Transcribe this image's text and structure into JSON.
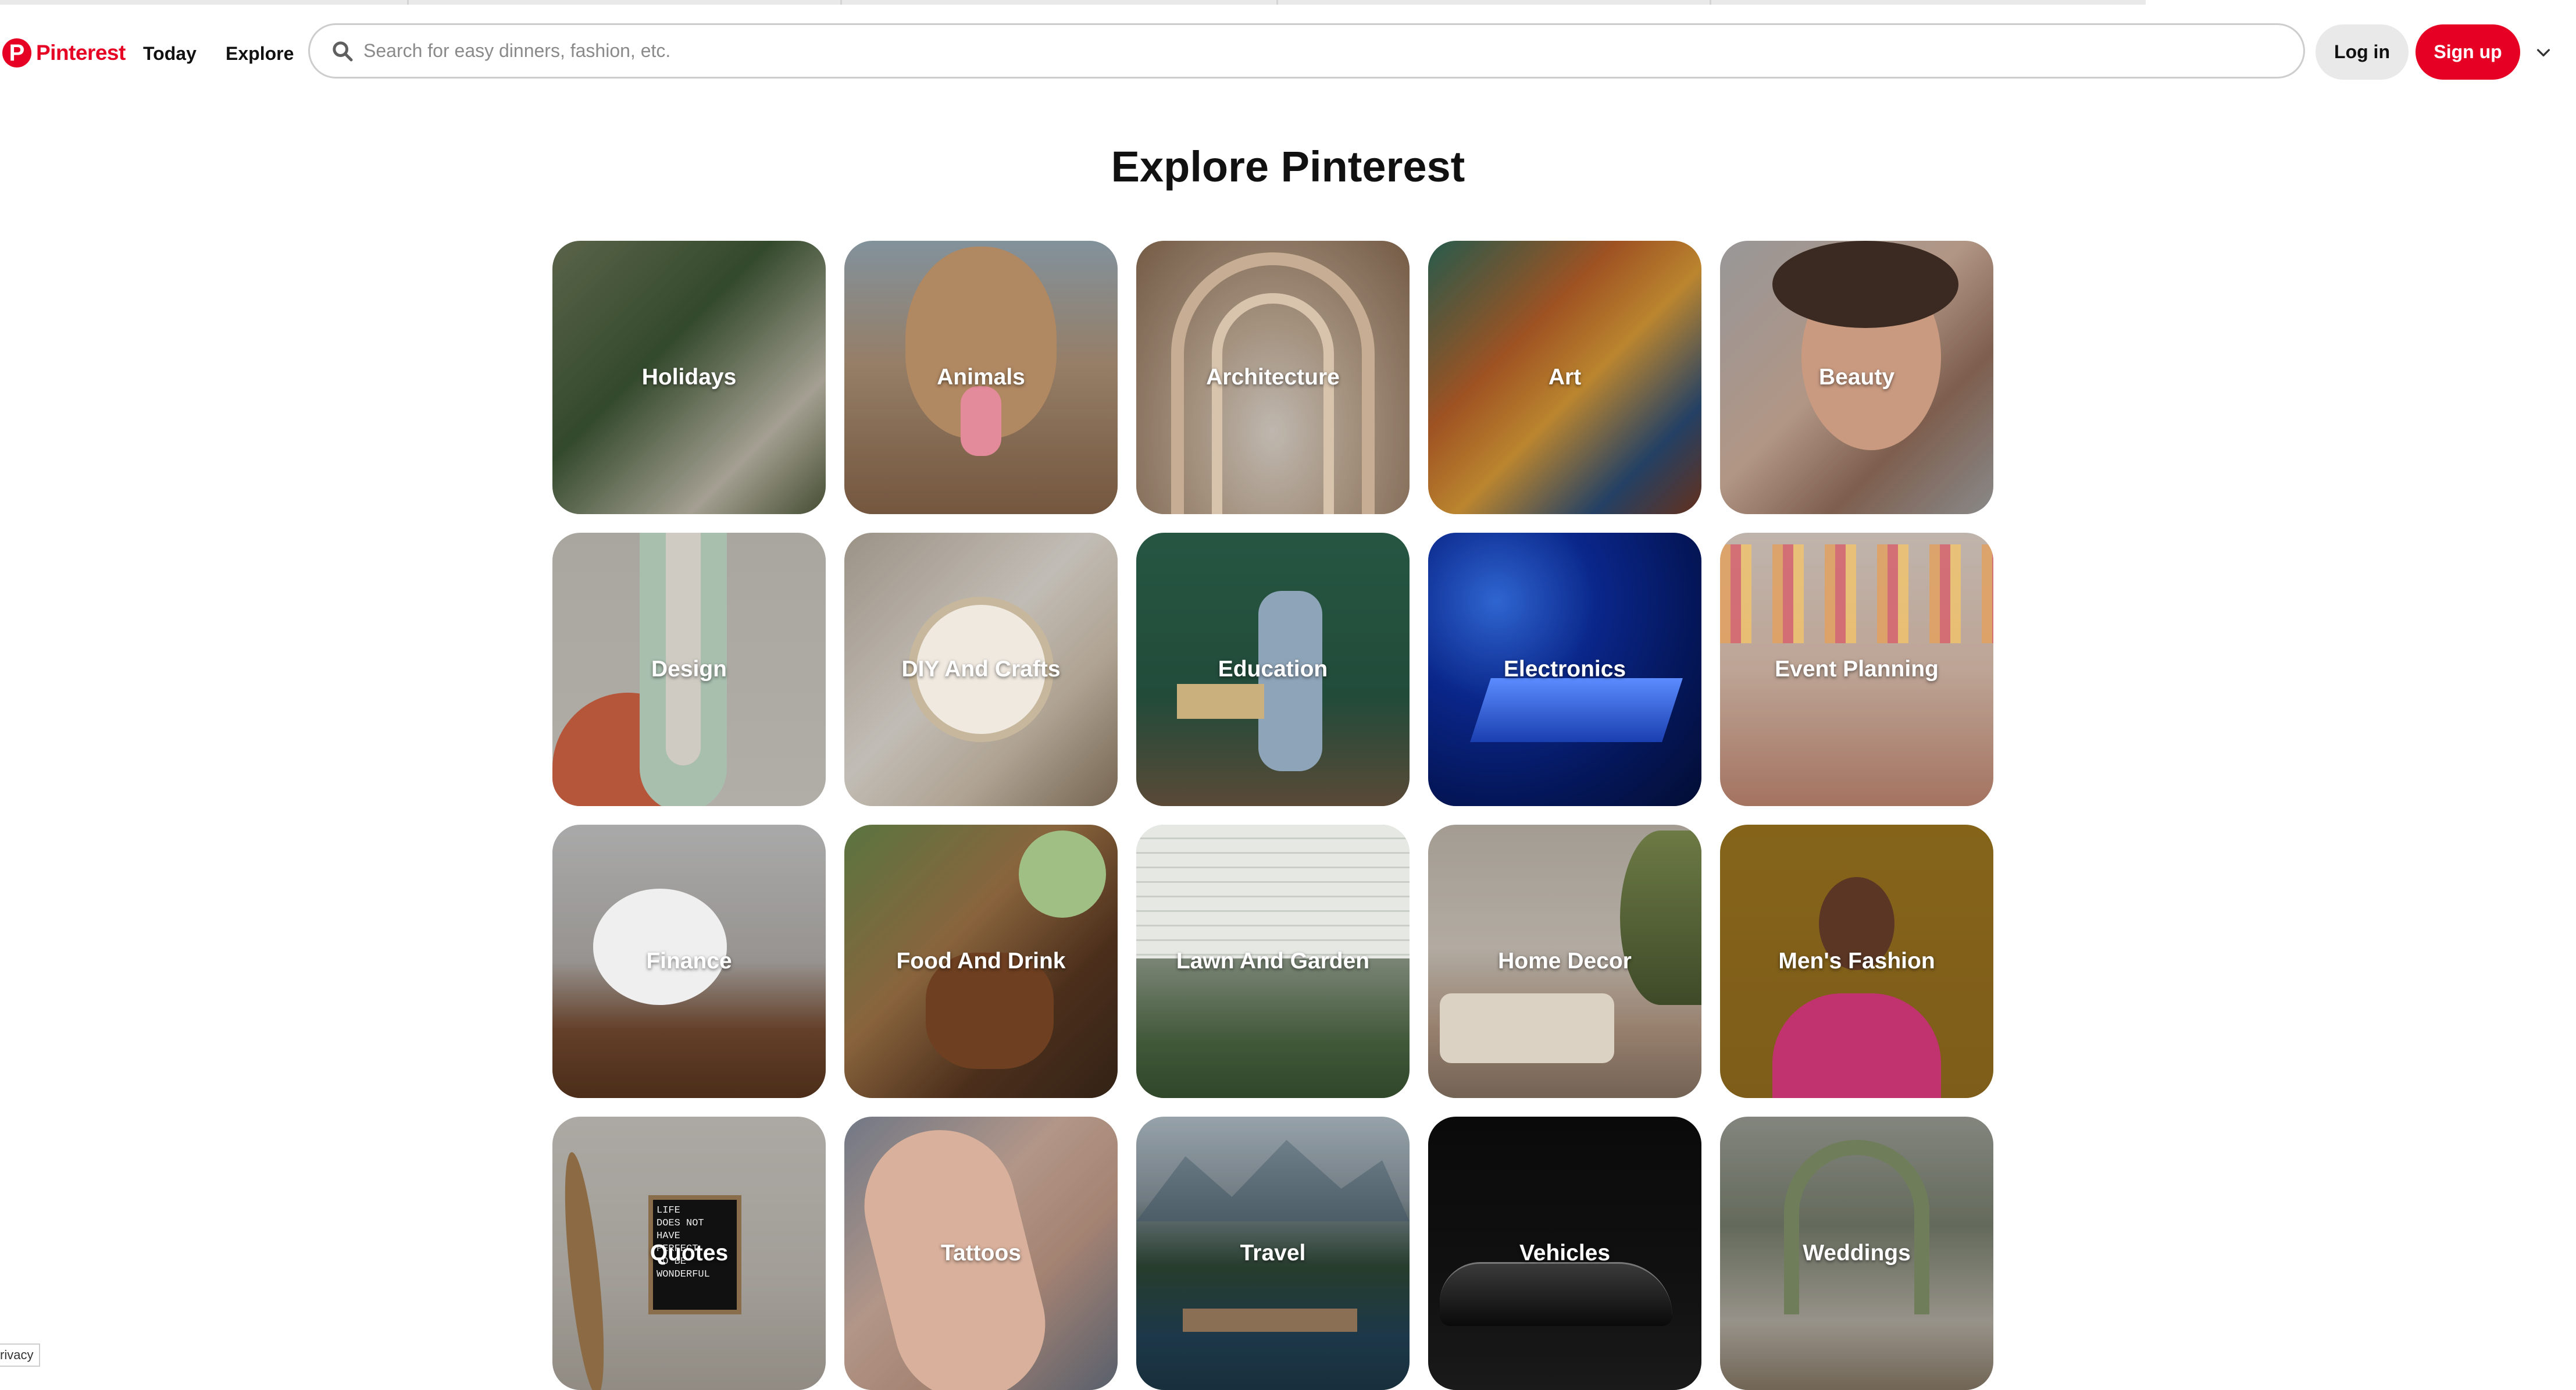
{
  "header": {
    "logo_mark": "P",
    "logo_text": "Pinterest",
    "nav": [
      "Today",
      "Explore"
    ],
    "search_placeholder": "Search for easy dinners, fashion, etc.",
    "login": "Log in",
    "signup": "Sign up"
  },
  "page_title": "Explore Pinterest",
  "categories": [
    {
      "label": "Holidays",
      "bg": "linear-gradient(135deg,#6f7a5a 0%,#3f5a36 40%,#c9c3b2 75%,#55603f 100%)"
    },
    {
      "label": "Animals",
      "bg": "linear-gradient(180deg,#9fb2be 0%,#b79a7e 45%,#8e6a4c 100%)"
    },
    {
      "label": "Architecture",
      "bg": "radial-gradient(ellipse at 50% 70%,#e9e0d6 0%,#c9b29b 40%,#8d6f55 100%)"
    },
    {
      "label": "Art",
      "bg": "linear-gradient(135deg,#2f6f5d 0%,#c2652a 35%,#e4a33a 55%,#2c4f7a 80%,#7a3b22 100%)"
    },
    {
      "label": "Beauty",
      "bg": "linear-gradient(135deg,#b9b9b9 0%,#d9b7a3 45%,#9a7460 70%,#a8a8a8 100%)"
    },
    {
      "label": "Design",
      "bg": "linear-gradient(180deg,#cfcbc3 0%,#d8d4cc 100%)"
    },
    {
      "label": "DIY And Crafts",
      "bg": "linear-gradient(135deg,#bfb3a4 0%,#ece6dd 45%,#d6c7b3 70%,#8f7b63 100%)"
    },
    {
      "label": "Education",
      "bg": "linear-gradient(180deg,#2f6a52 0%,#2a5c47 60%,#6e5a44 100%)"
    },
    {
      "label": "Electronics",
      "bg": "radial-gradient(circle at 25% 25%,#3a7cff 0%,#0c2fa8 35%,#061b6b 70%,#03113f 100%)"
    },
    {
      "label": "Event Planning",
      "bg": "linear-gradient(180deg,#eadcd2 0%,#e7c9b7 50%,#c98d76 100%)"
    },
    {
      "label": "Finance",
      "bg": "linear-gradient(180deg,#cfcfcf 0%,#b8b4b0 50%,#7a4e32 75%,#5c3820 100%)"
    },
    {
      "label": "Food And Drink",
      "bg": "linear-gradient(135deg,#6e8f4f 0%,#a87b4b 40%,#5d3a22 70%,#3e2a1c 100%)"
    },
    {
      "label": "Lawn And Garden",
      "bg": "linear-gradient(180deg,#d8dcd6 0%,#aab3a6 40%,#4f6b45 80%,#3b5734 100%)"
    },
    {
      "label": "Home Decor",
      "bg": "linear-gradient(180deg,#c7bfb3 0%,#d9d1c6 45%,#b99c86 75%,#8d7968 100%)"
    },
    {
      "label": "Men's Fashion",
      "bg": "linear-gradient(180deg,#a37a20 0%,#9a7220 100%)"
    },
    {
      "label": "Quotes",
      "bg": "linear-gradient(180deg,#d2cec8 0%,#c6c1b9 60%,#b1aaa0 100%)"
    },
    {
      "label": "Tattoos",
      "bg": "linear-gradient(135deg,#8a93a3 0%,#d9b7a6 40%,#c9a08c 65%,#6b7585 100%)"
    },
    {
      "label": "Travel",
      "bg": "linear-gradient(180deg,#b8c6cf 0%,#8a97a0 30%,#2f4a37 55%,#24455a 80%,#1e3a4a 100%)"
    },
    {
      "label": "Vehicles",
      "bg": "linear-gradient(180deg,#0d0d0d 0%,#151515 60%,#202020 100%)"
    },
    {
      "label": "Weddings",
      "bg": "linear-gradient(180deg,#a0a39a 0%,#7a8270 40%,#b9b3a8 75%,#8a7c68 100%)"
    }
  ],
  "quotes_board": [
    "LIFE",
    "DOES NOT",
    "HAVE",
    "PERFECT",
    "TO BE",
    "WONDERFUL"
  ],
  "privacy": "rivacy"
}
